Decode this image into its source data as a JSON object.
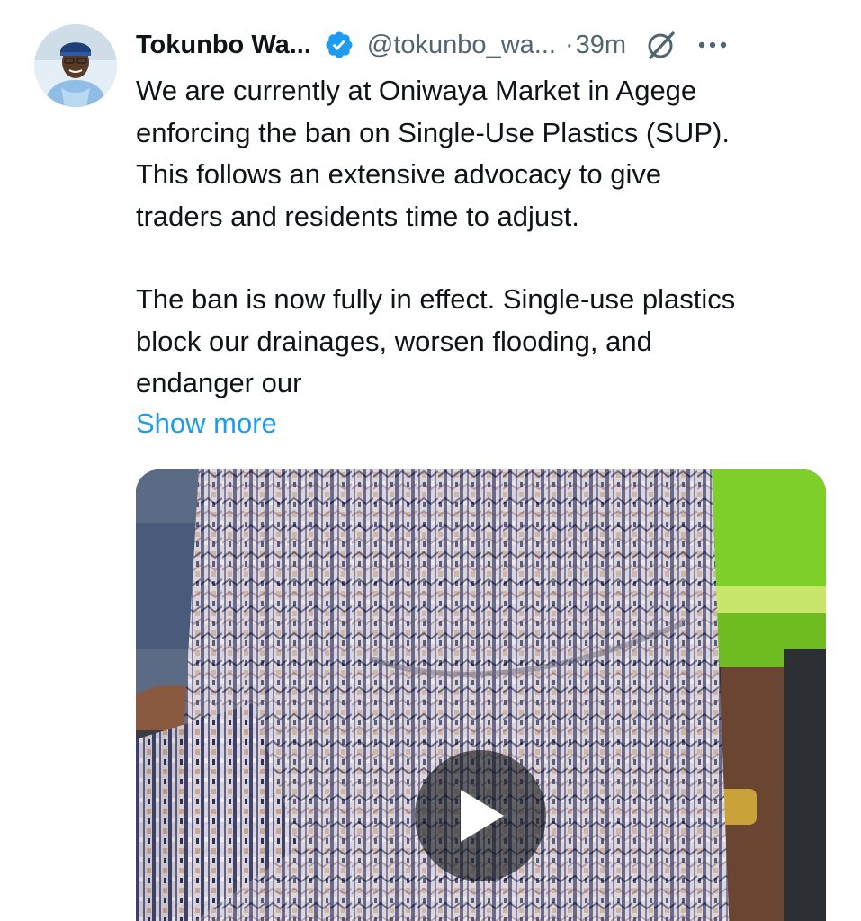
{
  "tweet": {
    "author_name": "Tokunbo Wa...",
    "handle": "@tokunbo_wa...",
    "separator": "·",
    "time": "39m",
    "verified_color": "#1d9bf0",
    "paragraphs": [
      [
        "We are currently at Oniwaya Market in Agege",
        "enforcing the ban on Single-Use Plastics (SUP).",
        "This follows an extensive advocacy to give",
        "traders and residents time to adjust."
      ],
      [
        "The ban is now fully in effect. Single-use plastics",
        "block our drainages, worsen flooding, and",
        "endanger our"
      ]
    ],
    "show_more_label": "Show more",
    "link_color": "#1d9bf0"
  },
  "icons": {
    "verified": "verified-badge-icon",
    "grok": "grok-icon",
    "more": "more-options-icon",
    "play": "play-icon"
  }
}
